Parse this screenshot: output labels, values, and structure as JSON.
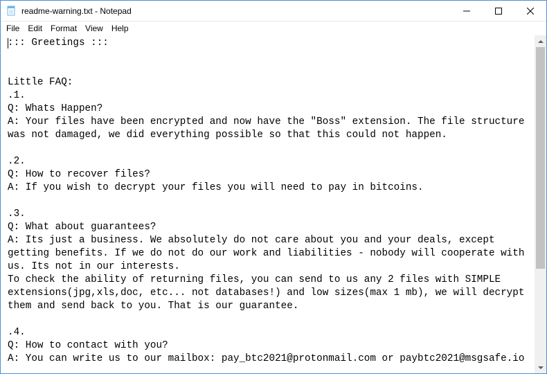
{
  "window": {
    "title": "readme-warning.txt - Notepad"
  },
  "menu": {
    "file": "File",
    "edit": "Edit",
    "format": "Format",
    "view": "View",
    "help": "Help"
  },
  "document": {
    "text": "::: Greetings :::\n\n\nLittle FAQ:\n.1.\nQ: Whats Happen?\nA: Your files have been encrypted and now have the \"Boss\" extension. The file structure was not damaged, we did everything possible so that this could not happen.\n\n.2.\nQ: How to recover files?\nA: If you wish to decrypt your files you will need to pay in bitcoins.\n\n.3.\nQ: What about guarantees?\nA: Its just a business. We absolutely do not care about you and your deals, except getting benefits. If we do not do our work and liabilities - nobody will cooperate with us. Its not in our interests.\nTo check the ability of returning files, you can send to us any 2 files with SIMPLE extensions(jpg,xls,doc, etc... not databases!) and low sizes(max 1 mb), we will decrypt them and send back to you. That is our guarantee.\n\n.4.\nQ: How to contact with you?\nA: You can write us to our mailbox: pay_btc2021@protonmail.com or paybtc2021@msgsafe.io"
  }
}
